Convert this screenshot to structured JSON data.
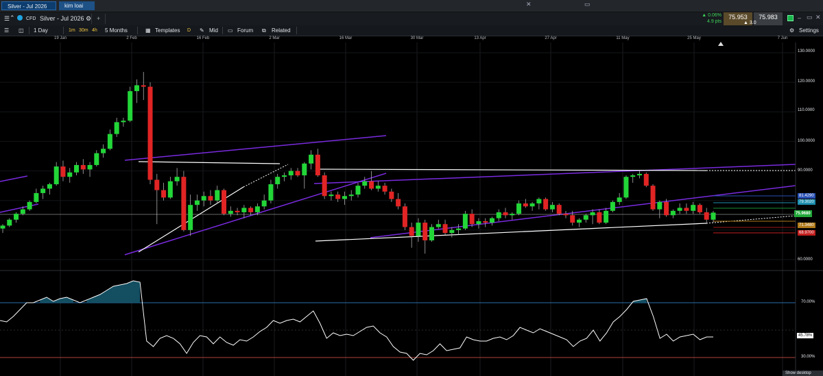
{
  "tabs": [
    "Silver - Jul 2026",
    "kim loai"
  ],
  "header": {
    "instrument_type": "CFD",
    "instrument_name": "Silver - Jul 2026",
    "add_symbol": "+"
  },
  "quote": {
    "change_pct": "▲ 0.06%",
    "change_pts": "4.9 pts",
    "bid": "75.953",
    "ask": "75.983",
    "spread": "▲ 3.0"
  },
  "toolbar": {
    "interval": "1 Day",
    "tf_1m": "1m",
    "tf_30m": "30m",
    "tf_4h": "4h",
    "period": "5 Months",
    "templates": "Templates",
    "draw": "D",
    "price_type": "Mid",
    "forum": "Forum",
    "related": "Related",
    "settings": "Settings"
  },
  "date_axis": [
    "19 Jan",
    "2 Feb",
    "16 Feb",
    "2 Mar",
    "16 Mar",
    "30 Mar",
    "13 Apr",
    "27 Apr",
    "11 May",
    "25 May",
    "7 Jun"
  ],
  "price_axis": [
    "130.0000",
    "120.0000",
    "110.0000",
    "100.0000",
    "90.0000",
    "60.0000"
  ],
  "price_pills": {
    "current": "75.9680",
    "blue": "81.4290",
    "cyan": "79.3020",
    "orange": "71.3480",
    "red": "68.9700"
  },
  "indicator_axis": [
    "70.00%",
    "30.00%"
  ],
  "indicator_value": "45.78%",
  "show_desktop": "Show desktop",
  "colors": {
    "up": "#22d638",
    "down": "#e12424",
    "trend_purple": "#7a2be0",
    "trend_white": "#ffffff",
    "indicator_fill": "#15566b"
  },
  "chart_data": {
    "type": "candlestick",
    "ylim": [
      55,
      135
    ],
    "candles": [
      [
        70.5,
        72.0,
        69.0,
        71.5
      ],
      [
        71.5,
        74.0,
        71.0,
        73.5
      ],
      [
        73.5,
        76.0,
        72.5,
        75.5
      ],
      [
        75.5,
        78.0,
        75.0,
        77.0
      ],
      [
        77.0,
        80.0,
        76.5,
        79.5
      ],
      [
        79.5,
        84.0,
        79.0,
        82.5
      ],
      [
        82.5,
        85.0,
        80.5,
        84.0
      ],
      [
        84.0,
        86.0,
        82.0,
        85.5
      ],
      [
        85.5,
        93.0,
        85.0,
        91.5
      ],
      [
        91.5,
        93.5,
        86.5,
        88.0
      ],
      [
        88.0,
        91.0,
        86.0,
        89.5
      ],
      [
        89.5,
        93.0,
        88.5,
        92.0
      ],
      [
        92.0,
        94.0,
        89.0,
        90.5
      ],
      [
        90.5,
        93.0,
        88.0,
        92.0
      ],
      [
        92.0,
        97.0,
        91.5,
        96.0
      ],
      [
        96.0,
        99.0,
        94.5,
        97.5
      ],
      [
        97.5,
        104.0,
        97.0,
        102.5
      ],
      [
        102.5,
        108.0,
        101.5,
        106.5
      ],
      [
        106.5,
        108.0,
        105.0,
        107.0
      ],
      [
        107.0,
        118.5,
        106.5,
        117.0
      ],
      [
        117.0,
        121.0,
        113.0,
        119.0
      ],
      [
        119.0,
        123.5,
        114.0,
        118.5
      ],
      [
        118.5,
        120.0,
        85.5,
        87.0
      ],
      [
        87.0,
        89.0,
        72.0,
        83.5
      ],
      [
        83.5,
        86.0,
        80.0,
        81.0
      ],
      [
        81.0,
        88.0,
        80.5,
        86.5
      ],
      [
        86.5,
        91.0,
        85.0,
        88.0
      ],
      [
        88.0,
        90.0,
        69.5,
        70.0
      ],
      [
        70.0,
        82.0,
        68.0,
        78.5
      ],
      [
        78.5,
        82.0,
        76.5,
        80.0
      ],
      [
        80.0,
        83.0,
        78.0,
        81.5
      ],
      [
        81.5,
        83.5,
        78.5,
        80.0
      ],
      [
        80.0,
        85.0,
        79.0,
        83.5
      ],
      [
        83.5,
        84.0,
        75.0,
        75.5
      ],
      [
        75.5,
        78.0,
        74.5,
        76.5
      ],
      [
        76.5,
        77.5,
        75.0,
        76.0
      ],
      [
        76.0,
        78.5,
        74.0,
        77.5
      ],
      [
        77.5,
        78.0,
        75.0,
        76.0
      ],
      [
        76.0,
        79.0,
        75.0,
        78.0
      ],
      [
        78.0,
        82.0,
        77.0,
        80.0
      ],
      [
        80.0,
        87.0,
        79.0,
        85.5
      ],
      [
        85.5,
        89.0,
        84.0,
        88.0
      ],
      [
        88.0,
        89.5,
        86.5,
        88.5
      ],
      [
        88.5,
        91.0,
        87.0,
        90.0
      ],
      [
        90.0,
        91.0,
        88.0,
        88.5
      ],
      [
        88.5,
        93.0,
        84.0,
        92.5
      ],
      [
        92.5,
        97.0,
        90.5,
        95.5
      ],
      [
        95.5,
        97.5,
        88.0,
        88.5
      ],
      [
        88.5,
        89.5,
        80.5,
        81.5
      ],
      [
        81.5,
        83.0,
        80.0,
        82.0
      ],
      [
        82.0,
        83.0,
        79.5,
        80.5
      ],
      [
        80.5,
        83.0,
        78.5,
        81.5
      ],
      [
        81.5,
        83.5,
        80.0,
        82.0
      ],
      [
        82.0,
        86.0,
        81.0,
        85.0
      ],
      [
        85.0,
        88.0,
        84.0,
        86.5
      ],
      [
        86.5,
        90.0,
        83.5,
        84.0
      ],
      [
        84.0,
        86.5,
        83.0,
        85.0
      ],
      [
        85.0,
        86.0,
        82.0,
        83.0
      ],
      [
        83.0,
        84.0,
        79.5,
        80.5
      ],
      [
        80.5,
        82.5,
        77.0,
        78.0
      ],
      [
        78.0,
        79.0,
        70.0,
        71.0
      ],
      [
        71.0,
        72.5,
        64.0,
        68.0
      ],
      [
        68.0,
        74.0,
        66.0,
        72.5
      ],
      [
        72.5,
        73.5,
        62.0,
        66.5
      ],
      [
        66.5,
        72.0,
        66.0,
        71.0
      ],
      [
        71.0,
        73.5,
        70.5,
        72.0
      ],
      [
        72.0,
        73.5,
        68.0,
        69.0
      ],
      [
        69.0,
        71.0,
        67.5,
        70.0
      ],
      [
        70.0,
        72.0,
        68.5,
        70.5
      ],
      [
        70.5,
        76.5,
        70.0,
        75.5
      ],
      [
        75.5,
        77.0,
        71.0,
        72.0
      ],
      [
        72.0,
        74.0,
        70.5,
        73.0
      ],
      [
        73.0,
        74.0,
        71.0,
        72.5
      ],
      [
        72.5,
        74.5,
        71.5,
        74.0
      ],
      [
        74.0,
        77.0,
        73.0,
        76.0
      ],
      [
        76.0,
        77.5,
        74.0,
        75.0
      ],
      [
        75.0,
        76.0,
        73.5,
        75.5
      ],
      [
        75.5,
        80.0,
        75.0,
        79.0
      ],
      [
        79.0,
        80.5,
        77.5,
        78.0
      ],
      [
        78.0,
        79.5,
        76.5,
        79.0
      ],
      [
        79.0,
        81.0,
        77.0,
        80.5
      ],
      [
        80.5,
        81.0,
        76.5,
        77.0
      ],
      [
        77.0,
        79.5,
        76.0,
        78.5
      ],
      [
        78.5,
        79.0,
        75.0,
        75.5
      ],
      [
        75.5,
        76.5,
        74.0,
        75.0
      ],
      [
        75.0,
        76.5,
        71.5,
        72.5
      ],
      [
        72.5,
        74.0,
        71.0,
        73.5
      ],
      [
        73.5,
        75.5,
        72.5,
        75.0
      ],
      [
        75.0,
        77.0,
        72.0,
        76.0
      ],
      [
        76.0,
        77.0,
        72.0,
        72.5
      ],
      [
        72.5,
        77.5,
        72.0,
        76.5
      ],
      [
        76.5,
        80.0,
        76.0,
        79.5
      ],
      [
        79.5,
        82.5,
        78.5,
        81.0
      ],
      [
        81.0,
        88.5,
        80.5,
        88.0
      ],
      [
        88.0,
        89.0,
        86.0,
        88.5
      ],
      [
        88.5,
        90.0,
        87.5,
        89.0
      ],
      [
        89.0,
        89.5,
        84.5,
        85.0
      ],
      [
        85.0,
        85.5,
        76.5,
        77.0
      ],
      [
        77.0,
        80.0,
        74.0,
        79.5
      ],
      [
        79.5,
        80.5,
        74.5,
        75.0
      ],
      [
        75.0,
        77.0,
        74.0,
        76.5
      ],
      [
        76.5,
        79.0,
        75.5,
        77.5
      ],
      [
        77.5,
        79.0,
        75.5,
        76.5
      ],
      [
        76.5,
        79.5,
        75.5,
        78.5
      ],
      [
        78.5,
        79.0,
        75.5,
        76.0
      ],
      [
        76.0,
        77.5,
        72.0,
        73.5
      ],
      [
        73.5,
        76.5,
        72.5,
        75.9
      ]
    ],
    "indicator": {
      "ylim": [
        25,
        95
      ],
      "upper_level": 70,
      "lower_level": 30,
      "values": [
        57,
        56,
        60,
        65,
        70,
        70,
        72,
        74,
        71,
        73,
        74,
        72,
        70,
        72,
        74,
        76,
        79,
        82,
        83,
        84,
        86,
        85,
        42,
        38,
        44,
        46,
        44,
        40,
        33,
        41,
        46,
        45,
        40,
        45,
        41,
        39,
        43,
        42,
        45,
        49,
        52,
        57,
        55,
        57,
        58,
        56,
        60,
        64,
        55,
        44,
        48,
        46,
        47,
        46,
        49,
        52,
        53,
        48,
        45,
        38,
        34,
        33,
        28,
        33,
        32,
        35,
        40,
        35,
        36,
        37,
        45,
        43,
        42,
        42,
        44,
        45,
        43,
        46,
        52,
        50,
        48,
        51,
        49,
        47,
        45,
        43,
        38,
        42,
        44,
        50,
        42,
        48,
        56,
        60,
        65,
        71,
        72,
        73,
        60,
        44,
        47,
        42,
        45,
        46,
        47,
        43,
        45,
        45
      ]
    }
  }
}
